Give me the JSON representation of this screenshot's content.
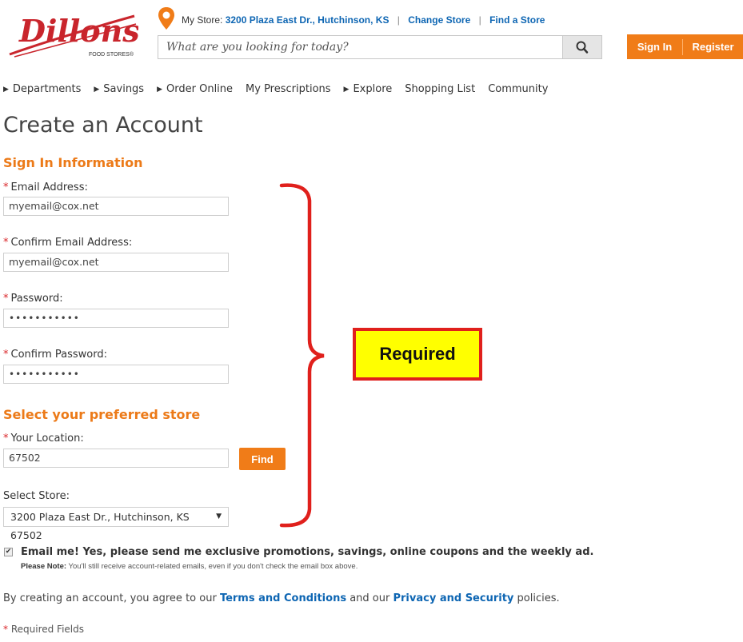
{
  "logo": {
    "text": "Dillons",
    "tagline": "FOOD STORES®"
  },
  "store_bar": {
    "prefix": "My Store:",
    "address": "3200 Plaza East Dr., Hutchinson, KS",
    "change_store": "Change Store",
    "find_store": "Find a Store"
  },
  "search": {
    "placeholder": "What are you looking for today?"
  },
  "auth": {
    "sign_in": "Sign In",
    "register": "Register"
  },
  "nav": [
    {
      "label": "Departments",
      "has_arrow": true
    },
    {
      "label": "Savings",
      "has_arrow": true
    },
    {
      "label": "Order Online",
      "has_arrow": true
    },
    {
      "label": "My Prescriptions",
      "has_arrow": false
    },
    {
      "label": "Explore",
      "has_arrow": true
    },
    {
      "label": "Shopping List",
      "has_arrow": false
    },
    {
      "label": "Community",
      "has_arrow": false
    }
  ],
  "page_title": "Create an Account",
  "signin_section": {
    "heading": "Sign In Information",
    "email_label": "Email Address:",
    "email_value": "myemail@cox.net",
    "confirm_email_label": "Confirm Email Address:",
    "confirm_email_value": "myemail@cox.net",
    "password_label": "Password:",
    "password_value": "•••••••••••",
    "confirm_password_label": "Confirm Password:",
    "confirm_password_value": "•••••••••••"
  },
  "store_section": {
    "heading": "Select your preferred store",
    "location_label": "Your Location:",
    "location_value": "67502",
    "find_button": "Find",
    "select_store_label": "Select Store:",
    "selected_store": "3200 Plaza East Dr., Hutchinson, KS 67502"
  },
  "annotation": {
    "label": "Required"
  },
  "email_opt_in": {
    "checked": true,
    "text": "Email me! Yes, please send me exclusive promotions, savings, online coupons and the weekly ad.",
    "note_prefix": "Please Note:",
    "note_text": "You'll still receive account-related emails, even if you don't check the email box above."
  },
  "terms": {
    "text_before": "By creating an account, you agree to our",
    "terms_link": "Terms and Conditions",
    "text_middle": "and our",
    "privacy_link": "Privacy and Security",
    "text_after": "policies."
  },
  "required_note": {
    "star": "*",
    "text": "Required Fields"
  },
  "colors": {
    "accent": "#f07c18",
    "link": "#0e66b3",
    "required_star": "#d9262a",
    "brand_red": "#c9252c",
    "annotation_red": "#e0201c",
    "annotation_yellow": "#ffff00"
  }
}
